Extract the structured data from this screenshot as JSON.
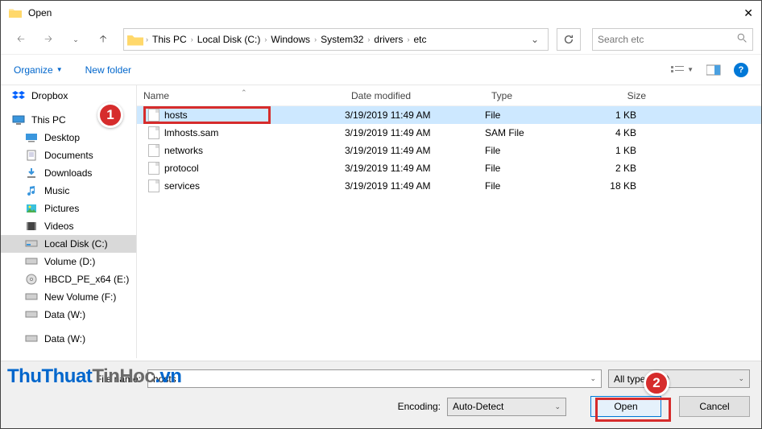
{
  "title": "Open",
  "breadcrumbs": [
    "This PC",
    "Local Disk (C:)",
    "Windows",
    "System32",
    "drivers",
    "etc"
  ],
  "search": {
    "placeholder": "Search etc"
  },
  "toolbar": {
    "organize": "Organize",
    "new_folder": "New folder"
  },
  "sidebar": {
    "items": [
      {
        "label": "Dropbox",
        "indent": false,
        "icon": "dropbox"
      },
      {
        "label": "This PC",
        "indent": false,
        "icon": "thispc"
      },
      {
        "label": "Desktop",
        "indent": true,
        "icon": "desktop"
      },
      {
        "label": "Documents",
        "indent": true,
        "icon": "documents"
      },
      {
        "label": "Downloads",
        "indent": true,
        "icon": "downloads"
      },
      {
        "label": "Music",
        "indent": true,
        "icon": "music"
      },
      {
        "label": "Pictures",
        "indent": true,
        "icon": "pictures"
      },
      {
        "label": "Videos",
        "indent": true,
        "icon": "videos"
      },
      {
        "label": "Local Disk (C:)",
        "indent": true,
        "icon": "drive",
        "selected": true
      },
      {
        "label": "Volume (D:)",
        "indent": true,
        "icon": "drive"
      },
      {
        "label": "HBCD_PE_x64 (E:)",
        "indent": true,
        "icon": "cd"
      },
      {
        "label": "New Volume (F:)",
        "indent": true,
        "icon": "drive"
      },
      {
        "label": "Data (W:)",
        "indent": true,
        "icon": "drive"
      },
      {
        "label": "Data (W:)",
        "indent": true,
        "icon": "drive"
      }
    ]
  },
  "columns": {
    "name": "Name",
    "date": "Date modified",
    "type": "Type",
    "size": "Size"
  },
  "files": [
    {
      "name": "hosts",
      "date": "3/19/2019 11:49 AM",
      "type": "File",
      "size": "1 KB",
      "selected": true
    },
    {
      "name": "lmhosts.sam",
      "date": "3/19/2019 11:49 AM",
      "type": "SAM File",
      "size": "4 KB"
    },
    {
      "name": "networks",
      "date": "3/19/2019 11:49 AM",
      "type": "File",
      "size": "1 KB"
    },
    {
      "name": "protocol",
      "date": "3/19/2019 11:49 AM",
      "type": "File",
      "size": "2 KB"
    },
    {
      "name": "services",
      "date": "3/19/2019 11:49 AM",
      "type": "File",
      "size": "18 KB"
    }
  ],
  "filename": {
    "label": "File name:",
    "value": "hosts"
  },
  "filter": {
    "label": "All types (*.*)"
  },
  "encoding": {
    "label": "Encoding:",
    "value": "Auto-Detect"
  },
  "buttons": {
    "open": "Open",
    "cancel": "Cancel"
  },
  "annotations": {
    "one": "1",
    "two": "2"
  },
  "watermark": {
    "p1": "ThuThuat",
    "p2": "TinHoc",
    "p3": ".vn"
  }
}
